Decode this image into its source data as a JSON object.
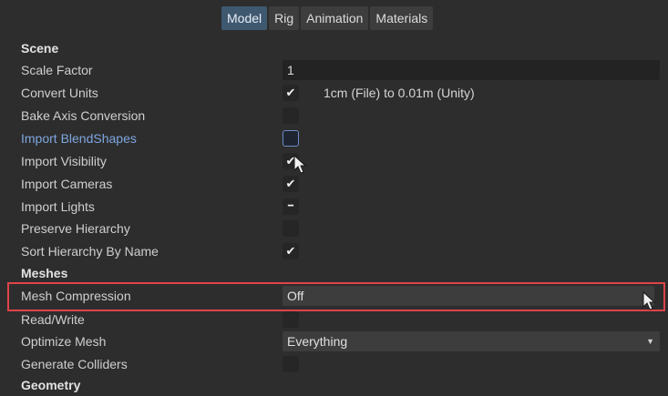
{
  "tabs": [
    {
      "label": "Model",
      "active": true
    },
    {
      "label": "Rig",
      "active": false
    },
    {
      "label": "Animation",
      "active": false
    },
    {
      "label": "Materials",
      "active": false
    }
  ],
  "scene": {
    "heading": "Scene",
    "scale_factor": {
      "label": "Scale Factor",
      "value": "1"
    },
    "convert_units": {
      "label": "Convert Units",
      "checked": true,
      "note": "1cm (File) to 0.01m (Unity)"
    },
    "bake_axis_conversion": {
      "label": "Bake Axis Conversion",
      "checked": false
    },
    "import_blendshapes": {
      "label": "Import BlendShapes",
      "checked": false
    },
    "import_visibility": {
      "label": "Import Visibility",
      "checked": true
    },
    "import_cameras": {
      "label": "Import Cameras",
      "checked": true
    },
    "import_lights": {
      "label": "Import Lights",
      "mixed": true
    },
    "preserve_hierarchy": {
      "label": "Preserve Hierarchy",
      "checked": false
    },
    "sort_hierarchy_by_name": {
      "label": "Sort Hierarchy By Name",
      "checked": true
    }
  },
  "meshes": {
    "heading": "Meshes",
    "mesh_compression": {
      "label": "Mesh Compression",
      "value": "Off"
    },
    "read_write": {
      "label": "Read/Write",
      "checked": false
    },
    "optimize_mesh": {
      "label": "Optimize Mesh",
      "value": "Everything"
    },
    "generate_colliders": {
      "label": "Generate Colliders",
      "checked": false
    }
  },
  "geometry": {
    "heading": "Geometry"
  },
  "glyphs": {
    "check": "✔",
    "mixed": "━",
    "dropdown_arrow": "▼"
  },
  "colors": {
    "highlight": "#e0434a",
    "active_tab": "#3e5870",
    "link_label": "#7ea6e0"
  }
}
